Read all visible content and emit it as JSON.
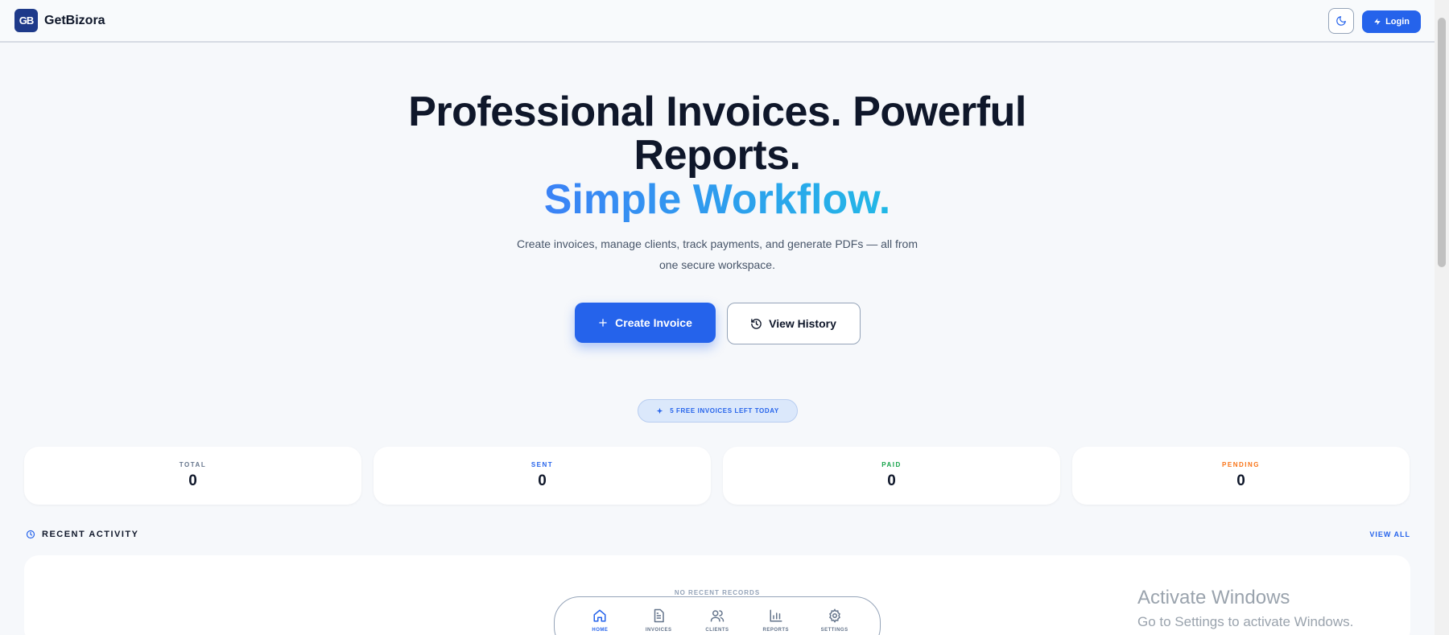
{
  "header": {
    "logo_text": "GB",
    "brand": "GetBizora",
    "login_label": "Login"
  },
  "hero": {
    "title": "Professional Invoices. Powerful Reports.",
    "accent": "Simple Workflow.",
    "subtitle": "Create invoices, manage clients, track payments, and generate PDFs — all from one secure workspace.",
    "primary_label": "Create Invoice",
    "secondary_label": "View History"
  },
  "free_pill": "5 FREE INVOICES LEFT TODAY",
  "stats": [
    {
      "label": "TOTAL",
      "value": "0",
      "color": "#64748b"
    },
    {
      "label": "SENT",
      "value": "0",
      "color": "#2563eb"
    },
    {
      "label": "PAID",
      "value": "0",
      "color": "#16a34a"
    },
    {
      "label": "PENDING",
      "value": "0",
      "color": "#f97316"
    }
  ],
  "recent": {
    "title": "RECENT ACTIVITY",
    "view_all": "VIEW ALL",
    "empty": "NO RECENT RECORDS"
  },
  "nav": [
    {
      "label": "HOME",
      "icon": "home-icon"
    },
    {
      "label": "INVOICES",
      "icon": "invoice-icon"
    },
    {
      "label": "CLIENTS",
      "icon": "clients-icon"
    },
    {
      "label": "REPORTS",
      "icon": "reports-icon"
    },
    {
      "label": "SETTINGS",
      "icon": "settings-icon"
    }
  ],
  "watermark": {
    "title": "Activate Windows",
    "subtitle": "Go to Settings to activate Windows."
  },
  "colors": {
    "accent": "#2563eb",
    "gradient_start": "#3b82f6",
    "gradient_end": "#22b8e6"
  }
}
